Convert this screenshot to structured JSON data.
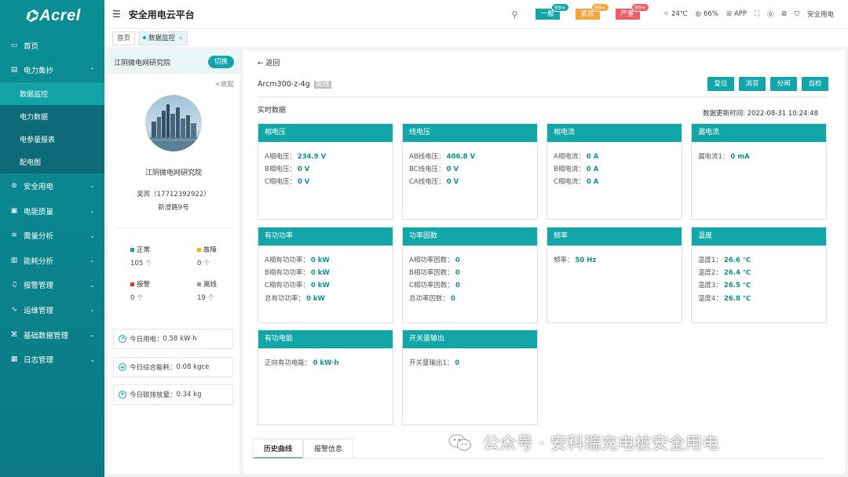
{
  "brand": "Acrel",
  "header": {
    "title": "安全用电云平台",
    "alarms": [
      {
        "label": "一般",
        "count": "99+"
      },
      {
        "label": "紧急",
        "count": "99+"
      },
      {
        "label": "严重",
        "count": "99+"
      }
    ],
    "weather_temp": "24℃",
    "humidity": "66%",
    "app_label": "APP",
    "user": "安全用电"
  },
  "tabs": [
    {
      "label": "首页"
    },
    {
      "label": "数据监控"
    }
  ],
  "sidebar": {
    "items": [
      {
        "label": "首页"
      },
      {
        "label": "电力集抄"
      },
      {
        "label": "安全用电"
      },
      {
        "label": "电能质量"
      },
      {
        "label": "需量分析"
      },
      {
        "label": "能耗分析"
      },
      {
        "label": "报警管理"
      },
      {
        "label": "运维管理"
      },
      {
        "label": "基础数据管理"
      },
      {
        "label": "日志管理"
      }
    ],
    "subitems": [
      {
        "label": "数据监控"
      },
      {
        "label": "电力数据"
      },
      {
        "label": "电参量报表"
      },
      {
        "label": "配电图"
      }
    ]
  },
  "left": {
    "site": "江阴微电网研究院",
    "switch": "切换",
    "collapse": "<收起",
    "org": "江阴微电网研究院",
    "contact": "吴宾（17712392922）",
    "address": "新澄路9号",
    "stats": [
      {
        "label": "正常",
        "value": "105",
        "unit": "个",
        "color": "#12a6a9"
      },
      {
        "label": "故障",
        "value": "0",
        "unit": "个",
        "color": "#f5b800"
      },
      {
        "label": "报警",
        "value": "0",
        "unit": "个",
        "color": "#e8323c"
      },
      {
        "label": "离线",
        "value": "19",
        "unit": "个",
        "color": "#999999"
      }
    ],
    "summary": [
      {
        "label": "今日用电：",
        "value": "0.58 kW·h"
      },
      {
        "label": "今日综合能耗：",
        "value": "0.08 kgce"
      },
      {
        "label": "今日碳排放量：",
        "value": "0.34 kg"
      }
    ]
  },
  "main": {
    "back": "返回",
    "device": "Arcm300-z-4g",
    "status": "离线",
    "actions": [
      "复位",
      "消音",
      "分闸",
      "自检"
    ],
    "realtime_label": "实时数据",
    "update_time": "数据更新时间: 2022-08-31 10:24:48",
    "cards": [
      {
        "title": "相电压",
        "rows": [
          {
            "k": "A相电压：",
            "v": "234.9 V"
          },
          {
            "k": "B相电压：",
            "v": "0 V"
          },
          {
            "k": "C相电压：",
            "v": "0 V"
          }
        ]
      },
      {
        "title": "线电压",
        "rows": [
          {
            "k": "AB线电压：",
            "v": "406.8 V"
          },
          {
            "k": "BC线电压：",
            "v": "0 V"
          },
          {
            "k": "CA线电压：",
            "v": "0 V"
          }
        ]
      },
      {
        "title": "相电流",
        "rows": [
          {
            "k": "A相电流：",
            "v": "0 A"
          },
          {
            "k": "B相电流：",
            "v": "0 A"
          },
          {
            "k": "C相电流：",
            "v": "0 A"
          }
        ]
      },
      {
        "title": "漏电流",
        "rows": [
          {
            "k": "漏电流1：",
            "v": "0 mA"
          }
        ]
      },
      {
        "title": "有功功率",
        "rows": [
          {
            "k": "A相有功功率：",
            "v": "0 kW"
          },
          {
            "k": "B相有功功率：",
            "v": "0 kW"
          },
          {
            "k": "C相有功功率：",
            "v": "0 kW"
          },
          {
            "k": "总有功功率：",
            "v": "0 kW"
          }
        ]
      },
      {
        "title": "功率因数",
        "rows": [
          {
            "k": "A相功率因数：",
            "v": "0"
          },
          {
            "k": "B相功率因数：",
            "v": "0"
          },
          {
            "k": "C相功率因数：",
            "v": "0"
          },
          {
            "k": "总功率因数：",
            "v": "0"
          }
        ]
      },
      {
        "title": "频率",
        "rows": [
          {
            "k": "频率：",
            "v": "50 Hz"
          }
        ]
      },
      {
        "title": "温度",
        "rows": [
          {
            "k": "温度1：",
            "v": "26.6 ℃"
          },
          {
            "k": "温度2：",
            "v": "26.4 ℃"
          },
          {
            "k": "温度3：",
            "v": "26.5 ℃"
          },
          {
            "k": "温度4：",
            "v": "26.8 ℃"
          }
        ]
      },
      {
        "title": "有功电能",
        "rows": [
          {
            "k": "正向有功电能：",
            "v": "0 kW·h"
          }
        ]
      },
      {
        "title": "开关量输出",
        "rows": [
          {
            "k": "开关量输出1：",
            "v": "0"
          }
        ]
      }
    ],
    "bottom_tabs": [
      "历史曲线",
      "报警信息"
    ]
  },
  "watermark": "公众号 · 安科瑞充电桩安全用电"
}
